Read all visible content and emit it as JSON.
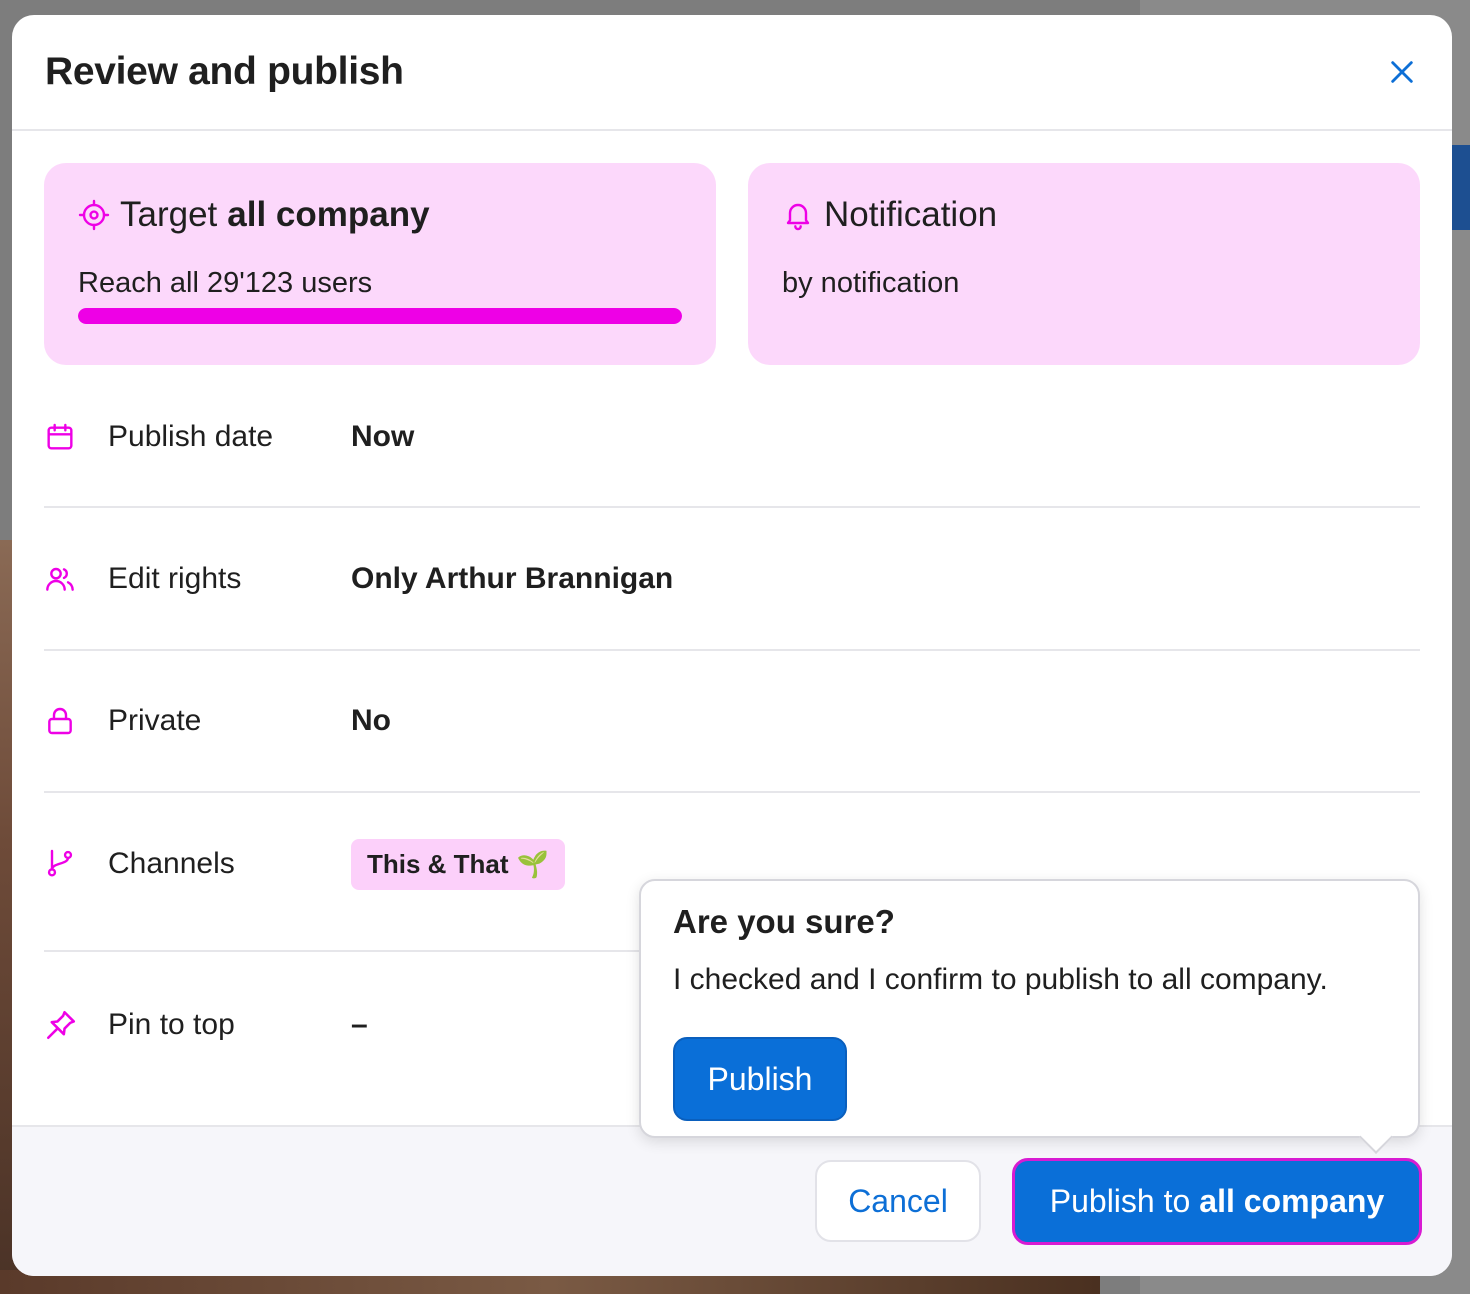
{
  "dialog": {
    "title": "Review and publish"
  },
  "target_card": {
    "label": "Target",
    "scope": "all company",
    "reach_text": "Reach all 29'123 users",
    "reach_progress_fraction": 1.0
  },
  "notification_card": {
    "title": "Notification",
    "subtitle": "by notification"
  },
  "settings": {
    "publish_date": {
      "label": "Publish date",
      "value": "Now"
    },
    "edit_rights": {
      "label": "Edit rights",
      "value": "Only Arthur Brannigan"
    },
    "private": {
      "label": "Private",
      "value": "No"
    },
    "channels": {
      "label": "Channels",
      "chip": "This & That",
      "chip_emoji": "🌱"
    },
    "pin_to_top": {
      "label": "Pin to top",
      "value": "–"
    }
  },
  "confirm_popover": {
    "title": "Are you sure?",
    "text": "I checked and I confirm to publish to all company.",
    "publish_label": "Publish"
  },
  "footer": {
    "cancel_label": "Cancel",
    "publish_prefix": "Publish to",
    "publish_scope": "all company"
  },
  "colors": {
    "accent_magenta": "#ee00e6",
    "card_bg": "#fcd8fb",
    "primary_blue": "#0a6fd8"
  },
  "icons": {
    "target": "target-icon",
    "notification": "bell-icon",
    "publish_date": "calendar-icon",
    "edit_rights": "users-icon",
    "private": "lock-icon",
    "channels": "branch-icon",
    "pin": "pin-icon",
    "close": "close-icon"
  }
}
